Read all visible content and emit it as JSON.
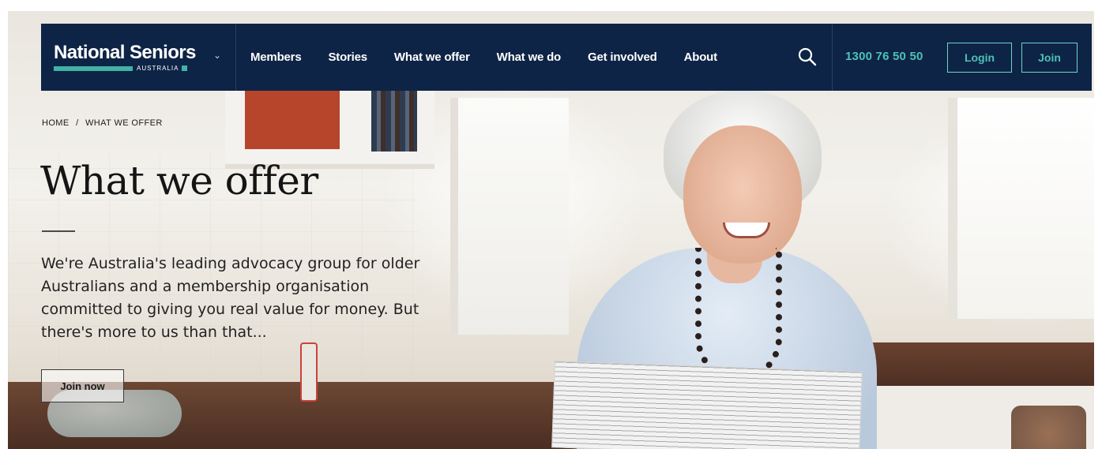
{
  "brand": {
    "name": "National Seniors",
    "sub": "AUSTRALIA",
    "accent_color": "#40b3a7",
    "nav_bg_color": "#0e2446"
  },
  "nav": {
    "links": [
      "Members",
      "Stories",
      "What we offer",
      "What we do",
      "Get involved",
      "About"
    ],
    "search_icon": "search-icon",
    "phone": "1300 76 50 50",
    "login_label": "Login",
    "join_label": "Join"
  },
  "hero": {
    "breadcrumb_home": "HOME",
    "breadcrumb_sep": "/",
    "breadcrumb_current": "WHAT WE OFFER",
    "title": "What we offer",
    "description": "We're Australia's leading advocacy group for older Australians and a membership organisation committed to giving you real value for money. But there's more to us than that...",
    "cta_label": "Join now"
  }
}
